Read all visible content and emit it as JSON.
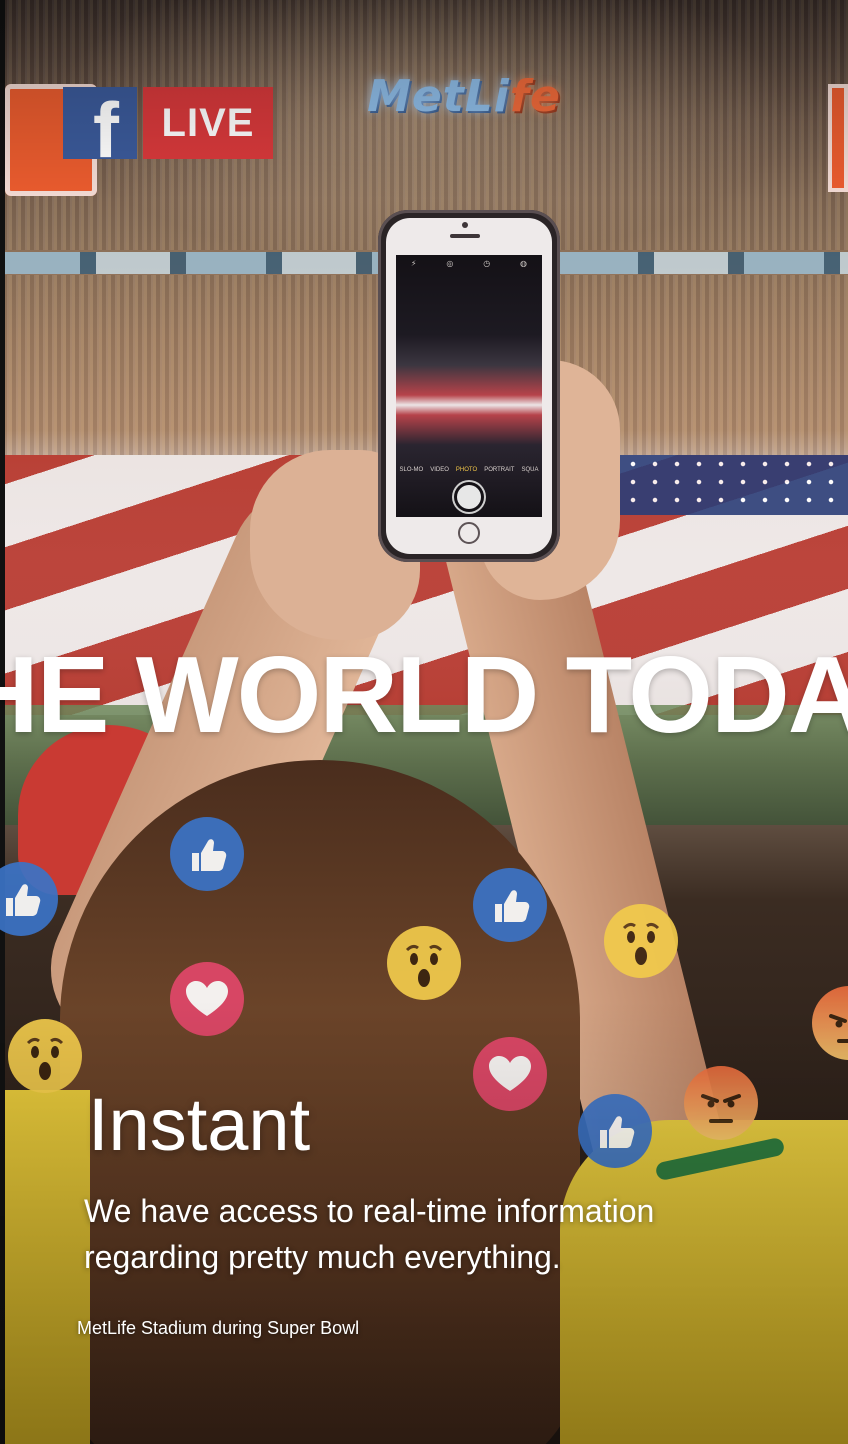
{
  "badge": {
    "brand_glyph": "f",
    "live_label": "LIVE",
    "brand_color": "#3b5a9a",
    "live_color": "#d8393b"
  },
  "stadium_sign": {
    "text_main": "MetLi",
    "text_accent": "fe"
  },
  "phone_screen": {
    "modes": [
      "SLO-MO",
      "VIDEO",
      "PHOTO",
      "PORTRAIT",
      "SQUA"
    ],
    "active_mode": "PHOTO"
  },
  "headline": {
    "text": "HE WORLD TODAY"
  },
  "reactions": {
    "like_icon": "thumbs-up-icon",
    "love_icon": "heart-icon",
    "wow_icon": "wow-face-icon",
    "angry_icon": "angry-face-icon"
  },
  "section": {
    "title": "Instant",
    "body": "We have access to real-time information regarding pretty much everything.",
    "caption": "MetLife Stadium during Super Bowl"
  },
  "colors": {
    "text": "#ffffff",
    "like": "#3b73c6",
    "love": "#e1476a",
    "wow": "#f2cb4c",
    "angry": "#e96a3c"
  }
}
